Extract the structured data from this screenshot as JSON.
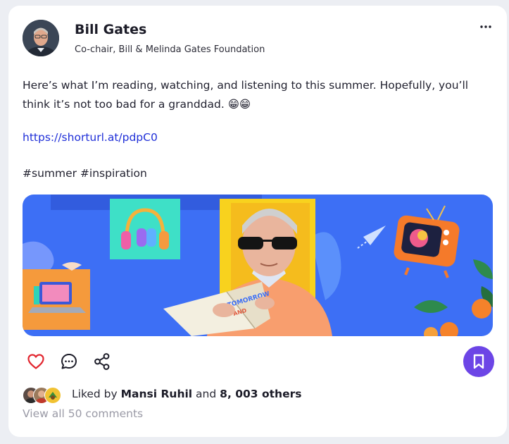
{
  "author": {
    "name": "Bill Gates",
    "title": "Co-chair, Bill & Melinda Gates Foundation"
  },
  "post": {
    "text": "Here’s what I’m reading, watching, and listening to this summer. Hopefully, you’ll think it’s not too bad for a granddad. 😁😁",
    "link": "https://shorturl.at/pdpC0",
    "hashtags": "#summer #inspiration",
    "book_title": "TOMORROW AND TOMORROW"
  },
  "icons": {
    "more": "more-horizontal-icon",
    "like": "heart-icon",
    "comment": "chat-bubble-icon",
    "share": "share-icon",
    "bookmark": "bookmark-icon"
  },
  "likes": {
    "prefix": "Liked by",
    "first_user": "Mansi Ruhil",
    "connector": "and",
    "others": "8, 003 others"
  },
  "comments": {
    "label": "View all 50 comments"
  },
  "colors": {
    "accent": "#6c45e6",
    "heart": "#e2262f",
    "link": "#1f2fd8",
    "muted": "#9a9aa6",
    "media_background": "#3d6ff5"
  }
}
